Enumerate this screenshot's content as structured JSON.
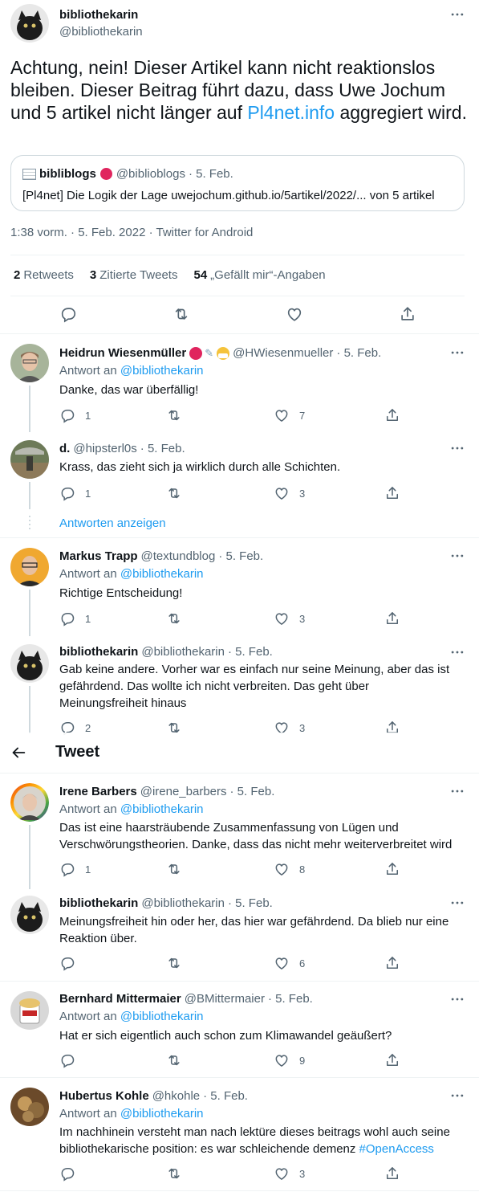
{
  "main": {
    "author_name": "bibliothekarin",
    "author_handle": "@bibliothekarin",
    "text_before": "Achtung, nein! Dieser Artikel kann nicht reaktionslos bleiben. Dieser Beitrag führt dazu, dass Uwe Jochum und 5 artikel nicht länger auf ",
    "text_link": "Pl4net.info",
    "text_after": " aggregiert wird.",
    "quote": {
      "name": "bibliblogs",
      "handle": "@biblioblogs",
      "date": "· 5. Feb.",
      "text": "[Pl4net] Die Logik der Lage uwejochum.github.io/5artikel/2022/... von 5 artikel"
    },
    "meta": "1:38 vorm. · 5. Feb. 2022 · Twitter for Android",
    "stats": {
      "retweets_num": "2",
      "retweets_label": "Retweets",
      "quotes_num": "3",
      "quotes_label": "Zitierte Tweets",
      "likes_num": "54",
      "likes_label": "„Gefällt mir“-Angaben"
    }
  },
  "header": {
    "back_icon": "arrow-left-icon",
    "title": "Tweet"
  },
  "replies": [
    {
      "name": "Heidrun Wiesenmüller",
      "handle": "@HWiesenmueller",
      "date": "· 5. Feb.",
      "reply_prefix": "Antwort an",
      "reply_to": "@bibliothekarin",
      "text": "Danke, das war überfällig!",
      "replies": "1",
      "retweets": "",
      "likes": "7"
    },
    {
      "name": "d.",
      "handle": "@hipsterl0s",
      "date": "· 5. Feb.",
      "text": "Krass, das zieht sich ja wirklich durch alle Schichten.",
      "replies": "1",
      "retweets": "",
      "likes": "3",
      "show_replies": "Antworten anzeigen"
    },
    {
      "name": "Markus Trapp",
      "handle": "@textundblog",
      "date": "· 5. Feb.",
      "reply_prefix": "Antwort an",
      "reply_to": "@bibliothekarin",
      "text": "Richtige Entscheidung!",
      "replies": "1",
      "retweets": "",
      "likes": "3"
    },
    {
      "name": "bibliothekarin",
      "handle": "@bibliothekarin",
      "date": "· 5. Feb.",
      "text": "Gab keine andere. Vorher war es einfach nur seine Meinung, aber das ist gefährdend. Das wollte ich nicht verbreiten. Das geht über Meinungsfreiheit hinaus",
      "replies": "2",
      "retweets": "",
      "likes": "3"
    },
    {
      "name": "Irene Barbers",
      "handle": "@irene_barbers",
      "date": "· 5. Feb.",
      "reply_prefix": "Antwort an",
      "reply_to": "@bibliothekarin",
      "text": "Das ist eine haarsträubende Zusammenfassung von Lügen und Verschwörungstheorien. Danke, dass das nicht mehr weiterverbreitet wird",
      "replies": "1",
      "retweets": "",
      "likes": "8"
    },
    {
      "name": "bibliothekarin",
      "handle": "@bibliothekarin",
      "date": "· 5. Feb.",
      "text": "Meinungsfreiheit hin oder her, das hier war gefährdend. Da blieb nur eine Reaktion über.",
      "replies": "",
      "retweets": "",
      "likes": "6"
    },
    {
      "name": "Bernhard Mittermaier",
      "handle": "@BMittermaier",
      "date": "· 5. Feb.",
      "reply_prefix": "Antwort an",
      "reply_to": "@bibliothekarin",
      "text": "Hat er sich eigentlich auch schon zum Klimawandel geäußert?",
      "replies": "",
      "retweets": "",
      "likes": "9"
    },
    {
      "name": "Hubertus Kohle",
      "handle": "@hkohle",
      "date": "· 5. Feb.",
      "reply_prefix": "Antwort an",
      "reply_to": "@bibliothekarin",
      "text_before": "Im nachhinein versteht man nach lektüre dieses beitrags wohl auch seine bibliothekarische position: es war schleichende demenz ",
      "hashtag": "#OpenAccess",
      "replies": "",
      "retweets": "",
      "likes": "3"
    }
  ],
  "colors": {
    "text": "#0f1419",
    "muted": "#536471",
    "link": "#1d9bf0",
    "divider": "#eff3f4",
    "badge_red": "#e0245e"
  }
}
